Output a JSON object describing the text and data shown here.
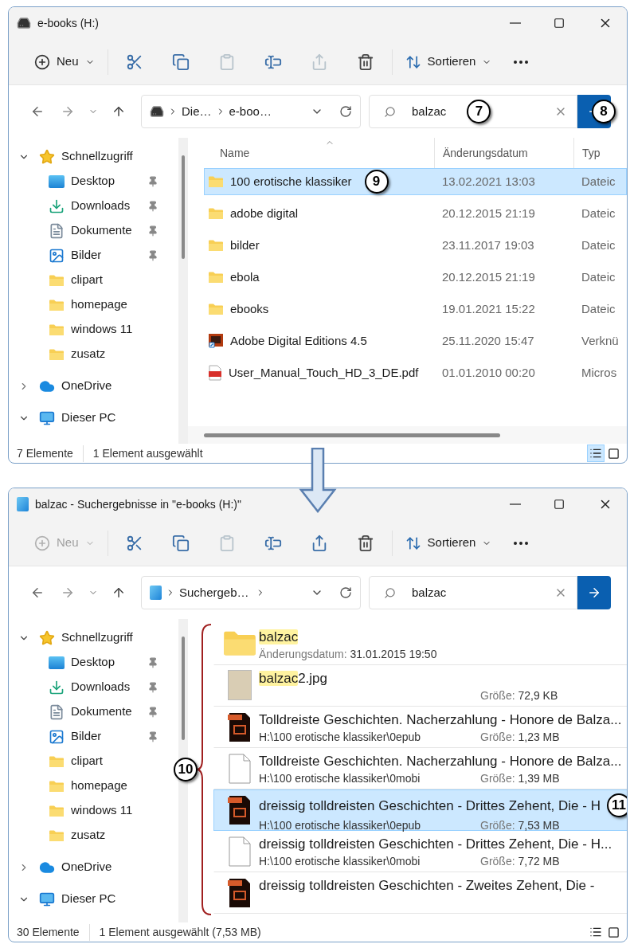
{
  "windows": [
    {
      "kind": "folder",
      "title": "e-books (H:)",
      "toolbar": [
        {
          "kind": "new",
          "label": "Neu",
          "disabled": false
        },
        {
          "kind": "cut",
          "disabled": false
        },
        {
          "kind": "copy",
          "disabled": false
        },
        {
          "kind": "paste",
          "disabled": true
        },
        {
          "kind": "rename",
          "disabled": false
        },
        {
          "kind": "share",
          "disabled": true
        },
        {
          "kind": "delete",
          "disabled": false
        },
        {
          "kind": "sort",
          "label": "Sortieren"
        },
        {
          "kind": "more"
        }
      ],
      "address": {
        "crumbs": [
          "Die…",
          "e-boo…"
        ],
        "trailing_chevron": false
      },
      "search": {
        "value": "balzac",
        "callout": "7"
      },
      "go_callout": "8",
      "sidebar": [
        {
          "kind": "star",
          "label": "Schnellzugriff",
          "expanded": true,
          "children": [
            {
              "kind": "desktop",
              "label": "Desktop",
              "pinned": true
            },
            {
              "kind": "download",
              "label": "Downloads",
              "pinned": true
            },
            {
              "kind": "document",
              "label": "Dokumente",
              "pinned": true
            },
            {
              "kind": "pictures",
              "label": "Bilder",
              "pinned": true
            },
            {
              "kind": "folder",
              "label": "clipart",
              "pinned": false
            },
            {
              "kind": "folder",
              "label": "homepage",
              "pinned": false
            },
            {
              "kind": "folder",
              "label": "windows 11",
              "pinned": false
            },
            {
              "kind": "folder",
              "label": "zusatz",
              "pinned": false
            }
          ]
        },
        {
          "kind": "cloud",
          "label": "OneDrive",
          "expanded": false
        },
        {
          "kind": "pc",
          "label": "Dieser PC",
          "expanded": true
        }
      ],
      "columns": [
        "Name",
        "Änderungsdatum",
        "Typ"
      ],
      "rows": [
        {
          "kind": "folder",
          "name": "100 erotische klassiker",
          "date": "13.02.2021 13:03",
          "type": "Dateic",
          "selected": true,
          "callout": "9"
        },
        {
          "kind": "folder",
          "name": "adobe digital",
          "date": "20.12.2015 21:19",
          "type": "Dateic",
          "selected": false
        },
        {
          "kind": "folder",
          "name": "bilder",
          "date": "23.11.2017 19:03",
          "type": "Dateic",
          "selected": false
        },
        {
          "kind": "folder",
          "name": "ebola",
          "date": "20.12.2015 21:19",
          "type": "Dateic",
          "selected": false
        },
        {
          "kind": "folder",
          "name": "ebooks",
          "date": "19.01.2021 15:22",
          "type": "Dateic",
          "selected": false
        },
        {
          "kind": "shortcut",
          "name": "Adobe Digital Editions 4.5",
          "date": "25.11.2020 15:47",
          "type": "Verknü",
          "selected": false
        },
        {
          "kind": "pdf",
          "name": "User_Manual_Touch_HD_3_DE.pdf",
          "date": "01.01.2010 00:20",
          "type": "Micros",
          "selected": false
        }
      ],
      "status": [
        "7 Elemente",
        "1 Element ausgewählt"
      ],
      "view_buttons": [
        {
          "kind": "details",
          "selected": true
        },
        {
          "kind": "tiles",
          "selected": false
        }
      ]
    },
    {
      "kind": "search",
      "title": "balzac - Suchergebnisse in \"e-books (H:)\"",
      "toolbar": [
        {
          "kind": "new",
          "label": "Neu",
          "disabled": true
        },
        {
          "kind": "cut",
          "disabled": false
        },
        {
          "kind": "copy",
          "disabled": false
        },
        {
          "kind": "paste",
          "disabled": true
        },
        {
          "kind": "rename",
          "disabled": false
        },
        {
          "kind": "share",
          "disabled": false
        },
        {
          "kind": "delete",
          "disabled": false
        },
        {
          "kind": "sort",
          "label": "Sortieren"
        },
        {
          "kind": "more"
        }
      ],
      "address": {
        "crumbs": [
          "Suchergeb…"
        ],
        "trailing_chevron": true
      },
      "search": {
        "value": "balzac"
      },
      "sidebar": [
        {
          "kind": "star",
          "label": "Schnellzugriff",
          "expanded": true,
          "children": [
            {
              "kind": "desktop",
              "label": "Desktop",
              "pinned": true
            },
            {
              "kind": "download",
              "label": "Downloads",
              "pinned": true
            },
            {
              "kind": "document",
              "label": "Dokumente",
              "pinned": true
            },
            {
              "kind": "pictures",
              "label": "Bilder",
              "pinned": true
            },
            {
              "kind": "folder",
              "label": "clipart",
              "pinned": false
            },
            {
              "kind": "folder",
              "label": "homepage",
              "pinned": false
            },
            {
              "kind": "folder",
              "label": "windows 11",
              "pinned": false
            },
            {
              "kind": "folder",
              "label": "zusatz",
              "pinned": false
            }
          ]
        },
        {
          "kind": "cloud",
          "label": "OneDrive",
          "expanded": false
        },
        {
          "kind": "pc",
          "label": "Dieser PC",
          "expanded": true
        }
      ],
      "list_callout": "10",
      "items": [
        {
          "kind": "folder",
          "name_parts": [
            {
              "text": "balzac",
              "highlight": true
            }
          ],
          "details": [
            {
              "label": "Änderungsdatum:",
              "value": "31.01.2015 19:50"
            }
          ],
          "selected": false
        },
        {
          "kind": "image",
          "name_parts": [
            {
              "text": "balzac",
              "highlight": true
            },
            {
              "text": "2.jpg",
              "highlight": false
            }
          ],
          "details": [
            {
              "label": "Größe:",
              "value": "72,9 KB"
            }
          ],
          "selected": false
        },
        {
          "kind": "epub",
          "name_parts": [
            {
              "text": "Tolldreiste Geschichten. Nacherzahlung - Honore de Balza...",
              "highlight": false
            }
          ],
          "path": "H:\\100 erotische klassiker\\0epub",
          "details": [
            {
              "label": "Größe:",
              "value": "1,23 MB"
            }
          ],
          "selected": false
        },
        {
          "kind": "file",
          "name_parts": [
            {
              "text": "Tolldreiste Geschichten. Nacherzahlung - Honore de Balza...",
              "highlight": false
            }
          ],
          "path": "H:\\100 erotische klassiker\\0mobi",
          "details": [
            {
              "label": "Größe:",
              "value": "1,39 MB"
            }
          ],
          "selected": false
        },
        {
          "kind": "epub",
          "name_parts": [
            {
              "text": "dreissig tolldreisten Geschichten - Drittes Zehent, Die - H",
              "highlight": false
            }
          ],
          "path": "H:\\100 erotische klassiker\\0epub",
          "details": [
            {
              "label": "Größe:",
              "value": "7,53 MB"
            }
          ],
          "selected": true,
          "callout": "11"
        },
        {
          "kind": "file",
          "name_parts": [
            {
              "text": "dreissig tolldreisten Geschichten - Drittes Zehent, Die - H...",
              "highlight": false
            }
          ],
          "path": "H:\\100 erotische klassiker\\0mobi",
          "details": [
            {
              "label": "Größe:",
              "value": "7,72 MB"
            }
          ],
          "selected": false
        },
        {
          "kind": "epub",
          "name_parts": [
            {
              "text": "dreissig tolldreisten Geschichten - Zweites Zehent, Die -",
              "highlight": false
            }
          ],
          "selected": false
        }
      ],
      "status": [
        "30 Elemente",
        "1 Element ausgewählt (7,53 MB)"
      ],
      "view_buttons": [
        {
          "kind": "details",
          "selected": false
        },
        {
          "kind": "tiles",
          "selected": false
        }
      ]
    }
  ]
}
